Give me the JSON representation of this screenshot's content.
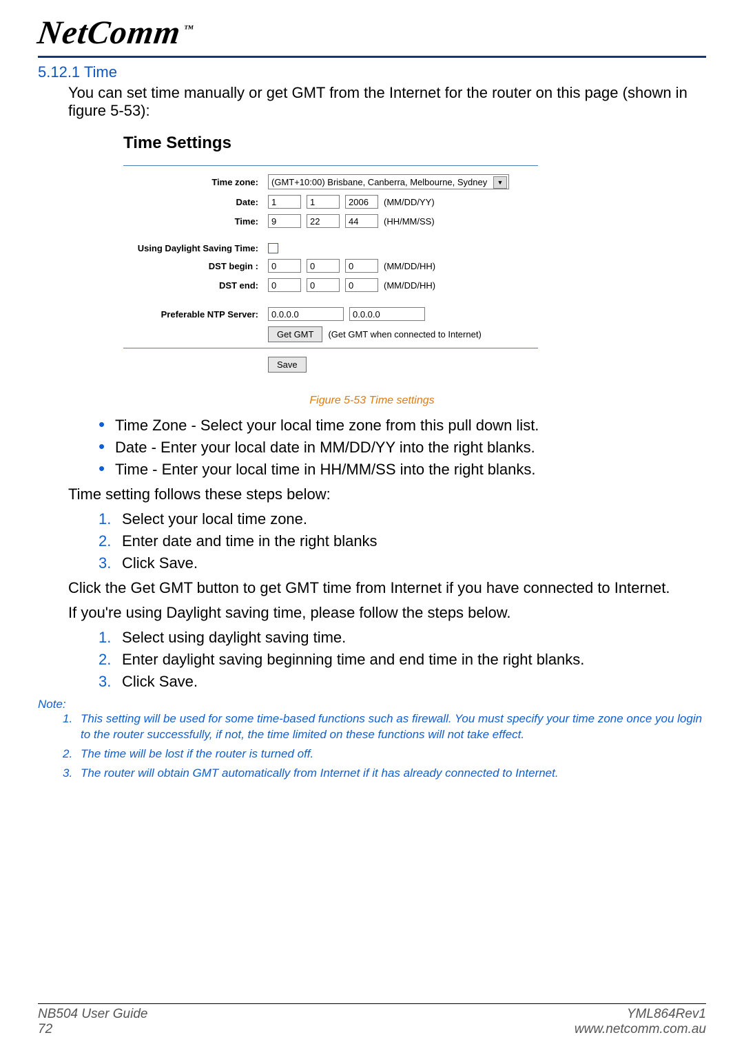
{
  "logo_text": "NetComm",
  "logo_tm": "™",
  "section": {
    "num": "5.12.1 Time"
  },
  "intro": "You can set time manually or get GMT from the Internet for the router on this page (shown in figure 5-53):",
  "panel": {
    "title": "Time Settings",
    "timezone_label": "Time zone:",
    "timezone_value": "(GMT+10:00) Brisbane, Canberra, Melbourne, Sydney",
    "date_label": "Date:",
    "date_m": "1",
    "date_d": "1",
    "date_y": "2006",
    "date_fmt": "(MM/DD/YY)",
    "time_label": "Time:",
    "time_h": "9",
    "time_m": "22",
    "time_s": "44",
    "time_fmt": "(HH/MM/SS)",
    "dst_use_label": "Using Daylight Saving Time:",
    "dst_begin_label": "DST begin :",
    "dst_begin_m": "0",
    "dst_begin_d": "0",
    "dst_begin_h": "0",
    "dst_begin_fmt": "(MM/DD/HH)",
    "dst_end_label": "DST end:",
    "dst_end_m": "0",
    "dst_end_d": "0",
    "dst_end_h": "0",
    "dst_end_fmt": "(MM/DD/HH)",
    "ntp_label": "Preferable NTP Server:",
    "ntp1": "0.0.0.0",
    "ntp2": "0.0.0.0",
    "get_gmt_btn": "Get GMT",
    "get_gmt_hint": "(Get GMT when connected to Internet)",
    "save_btn": "Save"
  },
  "caption": "Figure 5-53 Time settings",
  "bullets": [
    "Time Zone - Select your local time zone from this pull down list.",
    "Date - Enter your local date in MM/DD/YY into the right blanks.",
    "Time - Enter your local time in HH/MM/SS into the right blanks."
  ],
  "followup": "Time setting follows these steps below:",
  "steps1": [
    "Select your local time zone.",
    "Enter date and time in the right blanks",
    "Click Save."
  ],
  "para_gmt": "Click the Get GMT button to get GMT time from Internet if you have connected to Internet.",
  "para_dst": "If you're using Daylight saving time, please follow the steps below.",
  "steps2": [
    "Select using daylight saving time.",
    "Enter daylight saving beginning time and end time in the right blanks.",
    "Click Save."
  ],
  "note_head": "Note:",
  "notes": [
    "This setting will be used for some time-based functions such as firewall. You must specify your time zone once you login to the router successfully, if not, the time limited on these functions will not take effect.",
    "The time will be lost if the router is turned off.",
    "The router will obtain GMT automatically from Internet if it has already connected to Internet."
  ],
  "footer": {
    "left1": "NB504 User Guide",
    "left2": "72",
    "right1": "YML864Rev1",
    "right2": "www.netcomm.com.au"
  }
}
